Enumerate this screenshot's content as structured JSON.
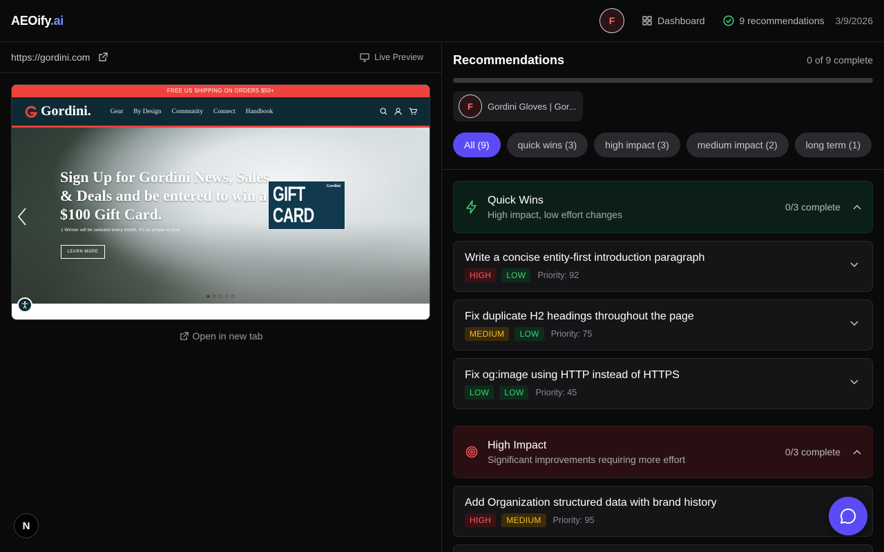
{
  "header": {
    "brand_main": "AEOify",
    "brand_suffix": ".ai",
    "avatar_letter": "F",
    "dashboard_label": "Dashboard",
    "recommendations_label": "9 recommendations",
    "date": "3/9/2026"
  },
  "preview": {
    "url": "https://gordini.com",
    "live_label": "Live Preview",
    "open_tab_label": "Open in new tab",
    "site": {
      "shipping_banner": "FREE US SHIPPING ON ORDERS $50+",
      "logo": "Gordini.",
      "nav": [
        "Gear",
        "By Design",
        "Community",
        "Connect",
        "Handbook"
      ],
      "hero_heading": "Sign Up for Gordini News, Sales & Deals and be entered to win a $100 Gift Card.",
      "hero_sub": "1 Winner will be selected every month. It's as simple as that.",
      "hero_button": "LEARN MORE",
      "gift_card_text": "GIFT CARD",
      "gift_card_brand": "Gordini"
    },
    "n_badge": "N"
  },
  "recommendations": {
    "title": "Recommendations",
    "complete_count": "0 of 9 complete",
    "progress_fraction": 0,
    "site_chip": {
      "letter": "F",
      "name": "Gordini Gloves | Gor..."
    },
    "filters": [
      "All (9)",
      "quick wins (3)",
      "high impact (3)",
      "medium impact (2)",
      "long term (1)"
    ],
    "groups": [
      {
        "title": "Quick Wins",
        "subtitle": "High impact, low effort changes",
        "count": "0/3 complete",
        "items": [
          {
            "title": "Write a concise entity-first introduction paragraph",
            "impact": "HIGH",
            "effort": "LOW",
            "priority": "Priority: 92"
          },
          {
            "title": "Fix duplicate H2 headings throughout the page",
            "impact": "MEDIUM",
            "effort": "LOW",
            "priority": "Priority: 75"
          },
          {
            "title": "Fix og:image using HTTP instead of HTTPS",
            "impact": "LOW",
            "effort": "LOW",
            "priority": "Priority: 45"
          }
        ]
      },
      {
        "title": "High Impact",
        "subtitle": "Significant improvements requiring more effort",
        "count": "0/3 complete",
        "items": [
          {
            "title": "Add Organization structured data with brand history",
            "impact": "HIGH",
            "effort": "MEDIUM",
            "priority": "Priority: 95"
          }
        ]
      }
    ]
  },
  "colors": {
    "accent": "#5b4bf5",
    "brand_ai": "#7c8cff",
    "high": "#ff5a62",
    "medium": "#f4bd2b",
    "low": "#3ed17a"
  }
}
